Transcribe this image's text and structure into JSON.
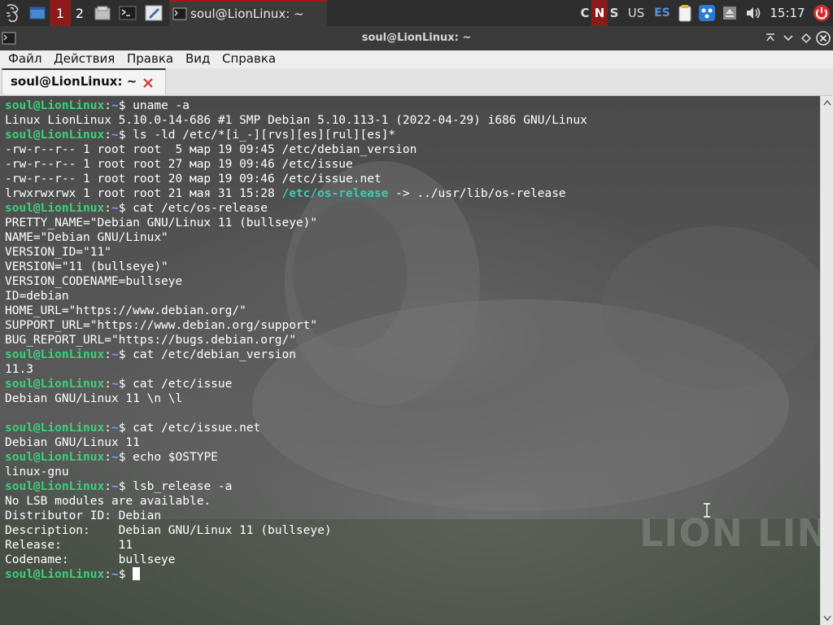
{
  "panel": {
    "workspaces": [
      "1",
      "2"
    ],
    "task_title": "soul@LionLinux: ~",
    "kb_indicators": [
      {
        "label": "C",
        "color": "#dddddd"
      },
      {
        "label": "N",
        "color": "#ffffff"
      },
      {
        "label": "S",
        "color": "#dddddd"
      }
    ],
    "layout_us": "US",
    "layout_es": "ES",
    "clock": "15:17",
    "accent": "#8b1a1a"
  },
  "window": {
    "title": "soul@LionLinux: ~"
  },
  "menu": {
    "file": "Файл",
    "actions": "Действия",
    "edit": "Правка",
    "view": "Вид",
    "help": "Справка"
  },
  "tab": {
    "label": "soul@LionLinux: ~"
  },
  "terminal": {
    "prompt_user": "soul@LionLinux",
    "prompt_colon": ":",
    "prompt_path": "~",
    "prompt_dollar": "$",
    "watermark": "LION LIN",
    "lines": [
      {
        "cmd": " uname -a"
      },
      {
        "out": "Linux LionLinux 5.10.0-14-686 #1 SMP Debian 5.10.113-1 (2022-04-29) i686 GNU/Linux"
      },
      {
        "cmd": " ls -ld /etc/*[i_-][rvs][es][rul][es]*"
      },
      {
        "out": "-rw-r--r-- 1 root root  5 мар 19 09:45 /etc/debian_version"
      },
      {
        "out": "-rw-r--r-- 1 root root 27 мар 19 09:46 /etc/issue"
      },
      {
        "out": "-rw-r--r-- 1 root root 20 мар 19 09:46 /etc/issue.net"
      },
      {
        "out": "lrwxrwxrwx 1 root root 21 мая 31 15:28 ",
        "link": "/etc/os-release",
        "tail": " -> ../usr/lib/os-release"
      },
      {
        "cmd": " cat /etc/os-release"
      },
      {
        "out": "PRETTY_NAME=\"Debian GNU/Linux 11 (bullseye)\""
      },
      {
        "out": "NAME=\"Debian GNU/Linux\""
      },
      {
        "out": "VERSION_ID=\"11\""
      },
      {
        "out": "VERSION=\"11 (bullseye)\""
      },
      {
        "out": "VERSION_CODENAME=bullseye"
      },
      {
        "out": "ID=debian"
      },
      {
        "out": "HOME_URL=\"https://www.debian.org/\""
      },
      {
        "out": "SUPPORT_URL=\"https://www.debian.org/support\""
      },
      {
        "out": "BUG_REPORT_URL=\"https://bugs.debian.org/\""
      },
      {
        "cmd": " cat /etc/debian_version"
      },
      {
        "out": "11.3"
      },
      {
        "cmd": " cat /etc/issue"
      },
      {
        "out": "Debian GNU/Linux 11 \\n \\l"
      },
      {
        "out": ""
      },
      {
        "cmd": " cat /etc/issue.net"
      },
      {
        "out": "Debian GNU/Linux 11"
      },
      {
        "cmd": " echo $OSTYPE"
      },
      {
        "out": "linux-gnu"
      },
      {
        "cmd": " lsb_release -a"
      },
      {
        "out": "No LSB modules are available."
      },
      {
        "out": "Distributor ID:\tDebian"
      },
      {
        "out": "Description:\tDebian GNU/Linux 11 (bullseye)"
      },
      {
        "out": "Release:\t11"
      },
      {
        "out": "Codename:\tbullseye"
      },
      {
        "cmd": " ",
        "cursor": true
      }
    ]
  }
}
